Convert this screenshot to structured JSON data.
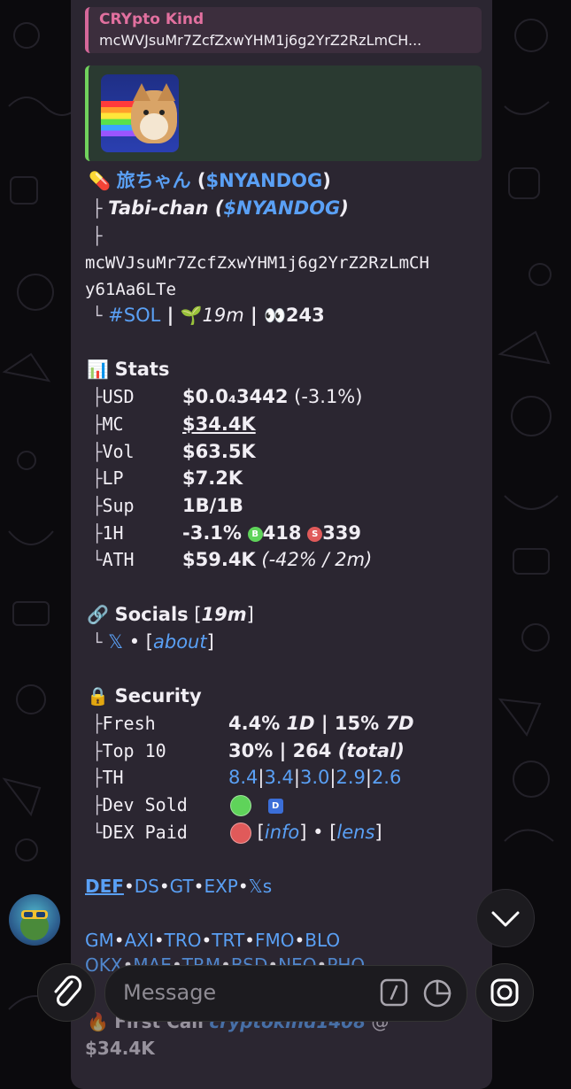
{
  "reply": {
    "title": "CRYpto Kind",
    "text": "mcWVJsuMr7ZcfZxwYHM1j6g2YrZ2RzLmCH..."
  },
  "token": {
    "emoji_pill": "💊",
    "name_jp": "旅ちゃん",
    "paren_open": " (",
    "ticker": "$NYANDOG",
    "paren_close": ")",
    "tree1": "├",
    "alt_name": "Tabi-chan",
    "alt_open": " (",
    "alt_ticker": "$NYANDOG",
    "alt_close": ")",
    "tree2": "├",
    "address_line1": "mcWVJsuMr7ZcfZxwYHM1j6g2YrZ2RzLmCH",
    "address_line2": "y61Aa6LTe",
    "tree3": "└",
    "chain": "#SOL",
    "sep": " | ",
    "seedling": "🌱",
    "age": "19m",
    "eyes": "👀",
    "views": "243"
  },
  "stats": {
    "icon": "📊",
    "title": "Stats",
    "rows": [
      {
        "tree": "├",
        "label": "USD",
        "value": "$0.0₄3442",
        "extra": " (-3.1%)"
      },
      {
        "tree": "├",
        "label": "MC",
        "value": "$34.4K"
      },
      {
        "tree": "├",
        "label": "Vol",
        "value": "$63.5K"
      },
      {
        "tree": "├",
        "label": "LP",
        "value": "$7.2K"
      },
      {
        "tree": "├",
        "label": "Sup",
        "value": "1B/1B"
      },
      {
        "tree": "├",
        "label": "1H",
        "value": "-3.1%",
        "buys_badge": "B",
        "buys": "418",
        "sells_badge": "S",
        "sells": "339"
      },
      {
        "tree": "└",
        "label": "ATH",
        "value": "$59.4K",
        "extra": " (-42% / 2m)"
      }
    ]
  },
  "socials": {
    "icon": "🔗",
    "title": "Socials",
    "age_open": " [",
    "age": "19m",
    "age_close": "]",
    "tree": "└",
    "x": "𝕏",
    "bullet": " • [",
    "about": "about",
    "close": "]"
  },
  "security": {
    "icon": "🔒",
    "title": "Security",
    "fresh": {
      "tree": "├",
      "label": "Fresh",
      "v1": "4.4%",
      "p1": " 1D",
      "sep": " | ",
      "v2": "15%",
      "p2": " 7D"
    },
    "top10": {
      "tree": "├",
      "label": "Top 10",
      "v1": "30%",
      "sep": " | ",
      "v2": "264",
      "p2": " (total)"
    },
    "th": {
      "tree": "├",
      "label": "TH",
      "values": [
        "8.4",
        "3.4",
        "3.0",
        "2.9",
        "2.6"
      ],
      "sep": "|"
    },
    "dev_sold": {
      "tree": "├",
      "label": "Dev Sold",
      "badge": "D"
    },
    "dex_paid": {
      "tree": "└",
      "label": "DEX Paid",
      "open": " [",
      "info": "info",
      "mid": "] • [",
      "lens": "lens",
      "close": "]"
    }
  },
  "links_row1": [
    "DEF",
    "DS",
    "GT",
    "EXP",
    "𝕏s"
  ],
  "links_row2": [
    "GM",
    "AXI",
    "TRO",
    "TRT",
    "FMO",
    "BLO"
  ],
  "links_row3": [
    "OKX",
    "MAE",
    "TRM",
    "BSD",
    "NEO",
    "PHO"
  ],
  "link_sep": "•",
  "first_call": {
    "icon": "🔥",
    "label": "First Call",
    "user": "cryptokind1408",
    "suffix": " @",
    "value": "$34.4K"
  },
  "input": {
    "placeholder": "Message"
  },
  "colors": {
    "accent": "#5aa0f5",
    "reply_bar": "#d5689a",
    "preview_bar": "#71d25d",
    "green": "#5fd35a",
    "red": "#e05a5a"
  }
}
